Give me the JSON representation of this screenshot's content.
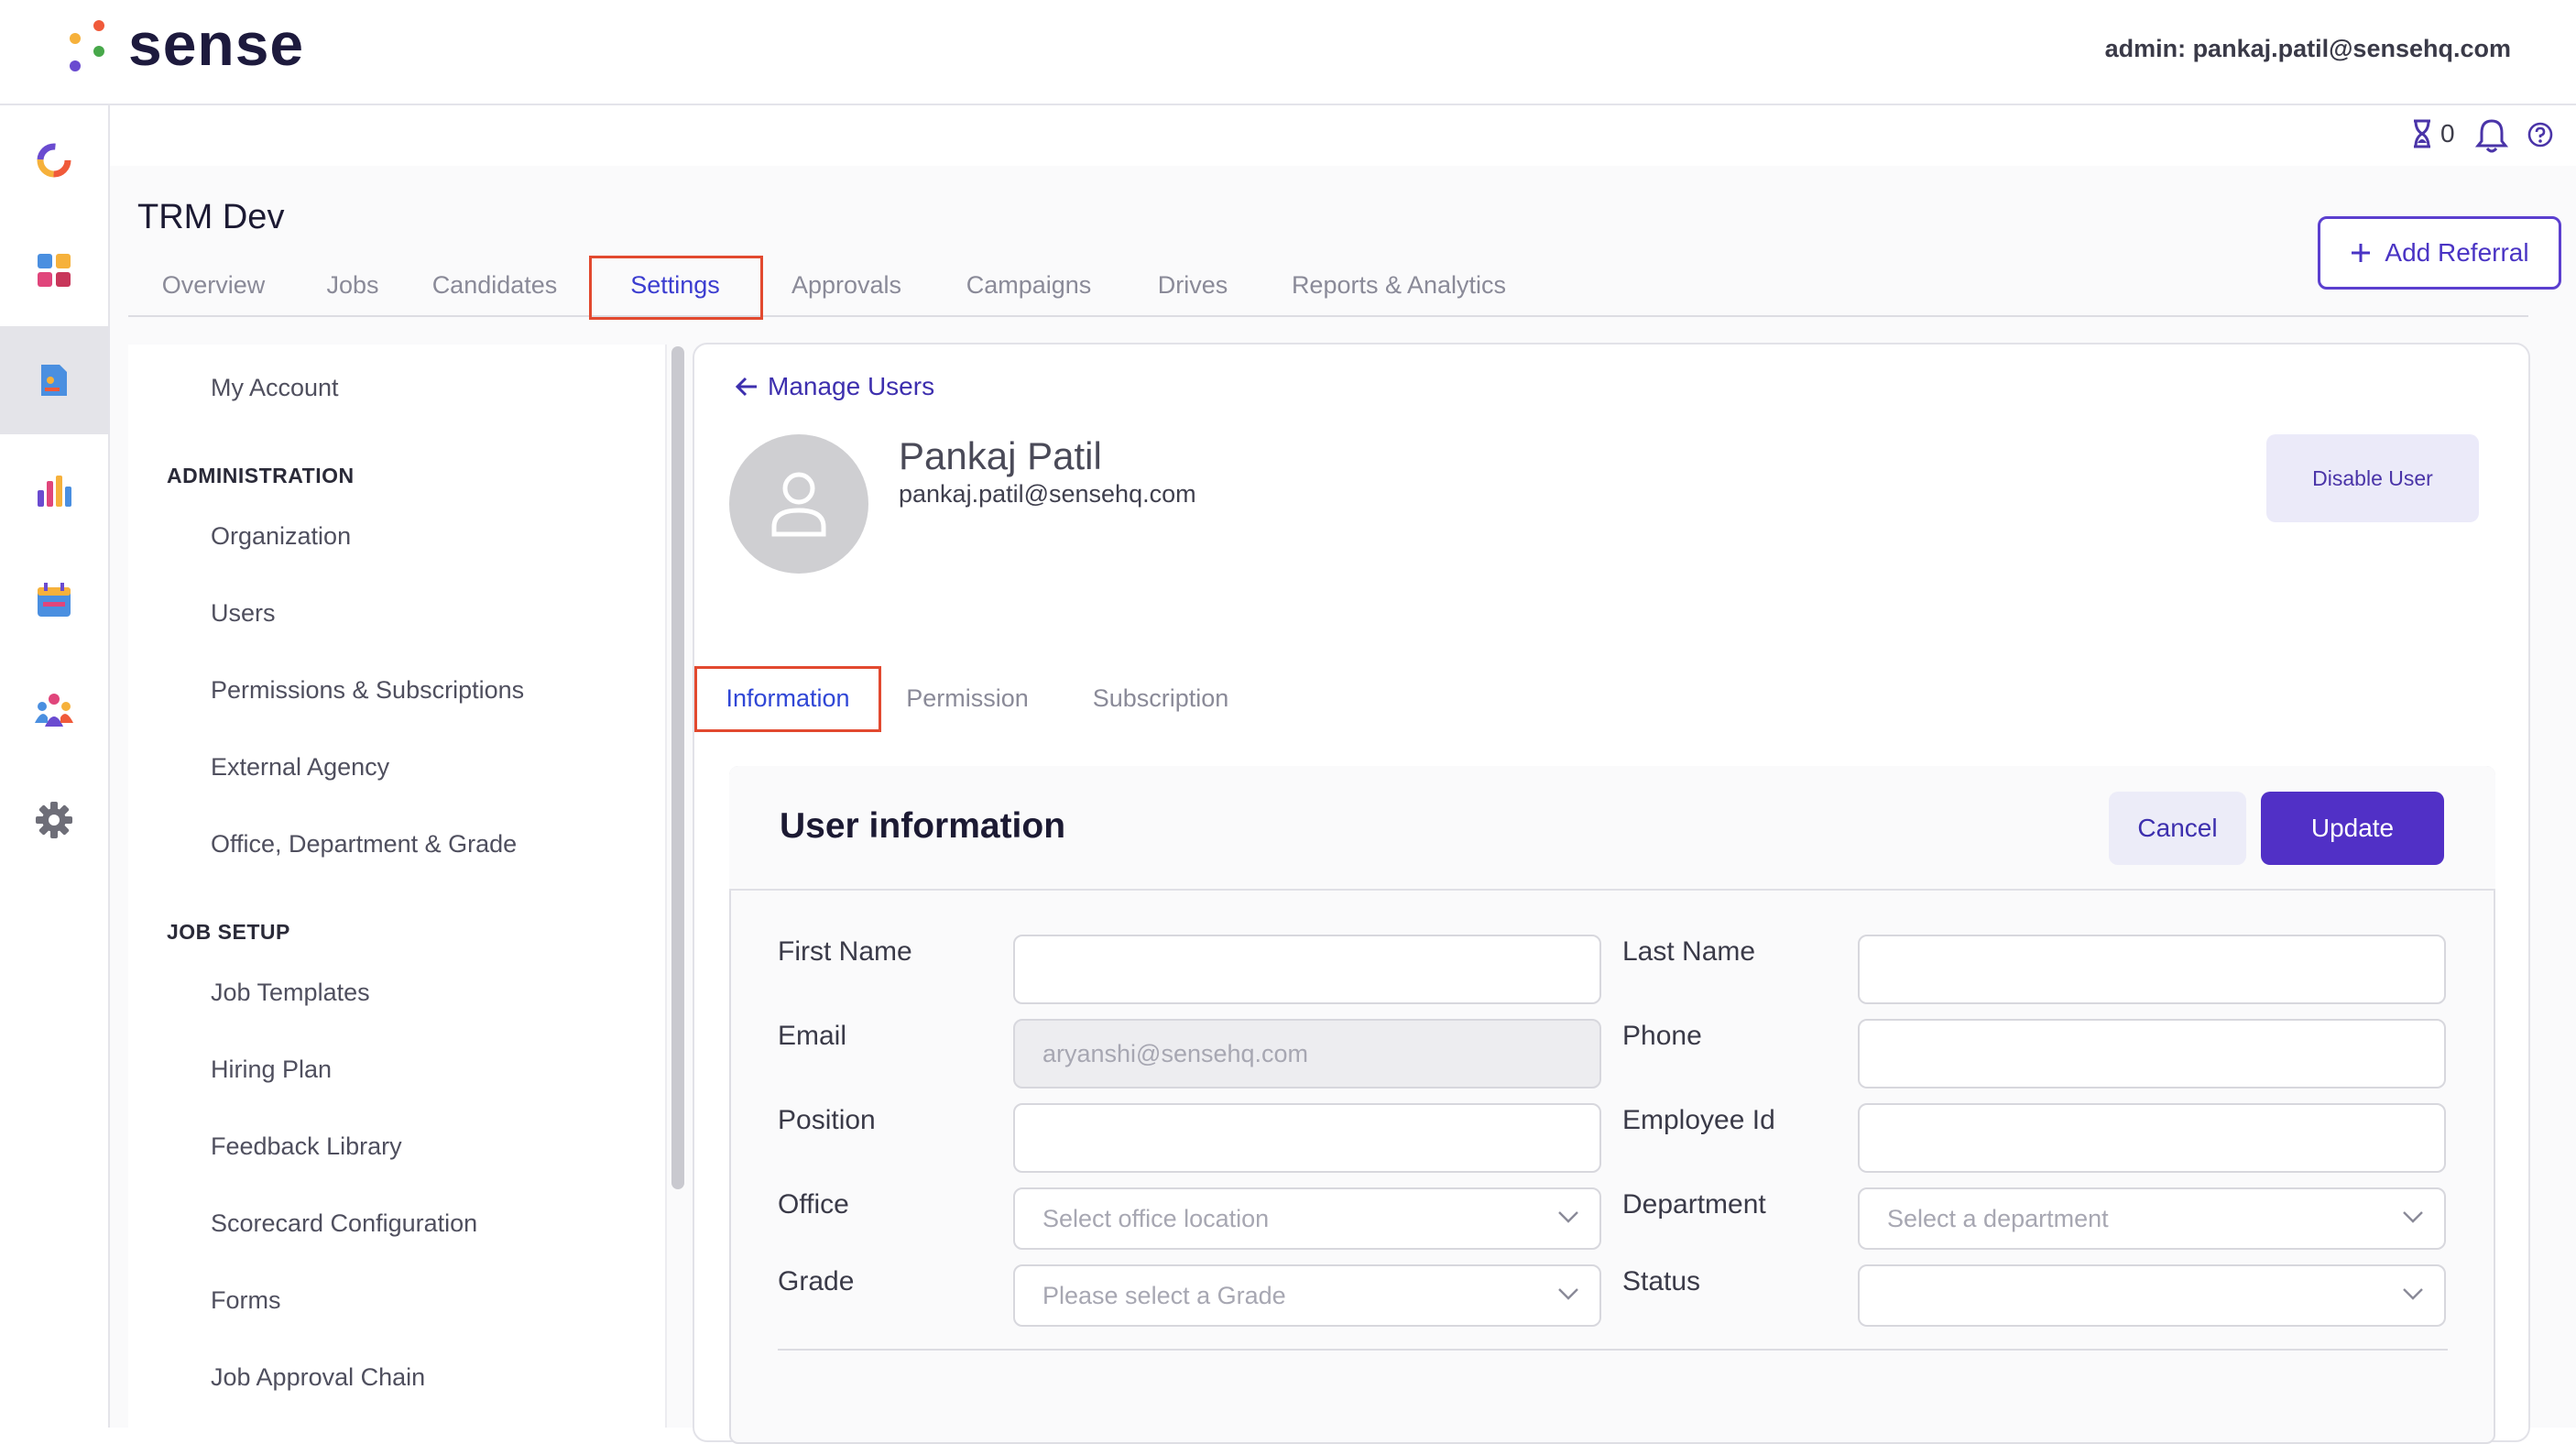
{
  "app": {
    "logo_text": "sense",
    "admin_label": "admin: pankaj.patil@sensehq.com",
    "hourglass_count": "0"
  },
  "rail": {
    "icons": [
      "sense-home-icon",
      "dashboard-icon",
      "document-icon",
      "analytics-icon",
      "calendar-icon",
      "people-icon",
      "gear-icon"
    ],
    "active": "document-icon"
  },
  "project": {
    "title": "TRM Dev",
    "add_referral_label": "Add Referral"
  },
  "tabs": {
    "items": [
      "Overview",
      "Jobs",
      "Candidates",
      "Settings",
      "Approvals",
      "Campaigns",
      "Drives",
      "Reports & Analytics"
    ],
    "active": "Settings"
  },
  "settings_nav": {
    "my_account": "My Account",
    "administration_heading": "ADMINISTRATION",
    "administration_items": [
      "Organization",
      "Users",
      "Permissions & Subscriptions",
      "External Agency",
      "Office, Department & Grade"
    ],
    "job_setup_heading": "JOB SETUP",
    "job_setup_items": [
      "Job Templates",
      "Hiring Plan",
      "Feedback Library",
      "Scorecard Configuration",
      "Forms",
      "Job Approval Chain"
    ]
  },
  "user": {
    "back_link": "Manage Users",
    "name": "Pankaj Patil",
    "email": "pankaj.patil@sensehq.com",
    "disable_label": "Disable User"
  },
  "subtabs": {
    "items": [
      "Information",
      "Permission",
      "Subscription"
    ],
    "active": "Information"
  },
  "user_info": {
    "title": "User information",
    "cancel_label": "Cancel",
    "update_label": "Update",
    "fields": {
      "first_name": {
        "label": "First Name",
        "value": ""
      },
      "last_name": {
        "label": "Last Name",
        "value": ""
      },
      "email": {
        "label": "Email",
        "value": "aryanshi@sensehq.com"
      },
      "phone": {
        "label": "Phone",
        "value": ""
      },
      "position": {
        "label": "Position",
        "value": ""
      },
      "employee_id": {
        "label": "Employee Id",
        "value": ""
      },
      "office": {
        "label": "Office",
        "placeholder": "Select office location"
      },
      "department": {
        "label": "Department",
        "placeholder": "Select a department"
      },
      "grade": {
        "label": "Grade",
        "placeholder": "Please select a Grade"
      },
      "status": {
        "label": "Status",
        "placeholder": ""
      }
    }
  },
  "colors": {
    "accent": "#5130c6",
    "tab_active": "#3b3dd0",
    "highlight_box": "#e2492f"
  }
}
